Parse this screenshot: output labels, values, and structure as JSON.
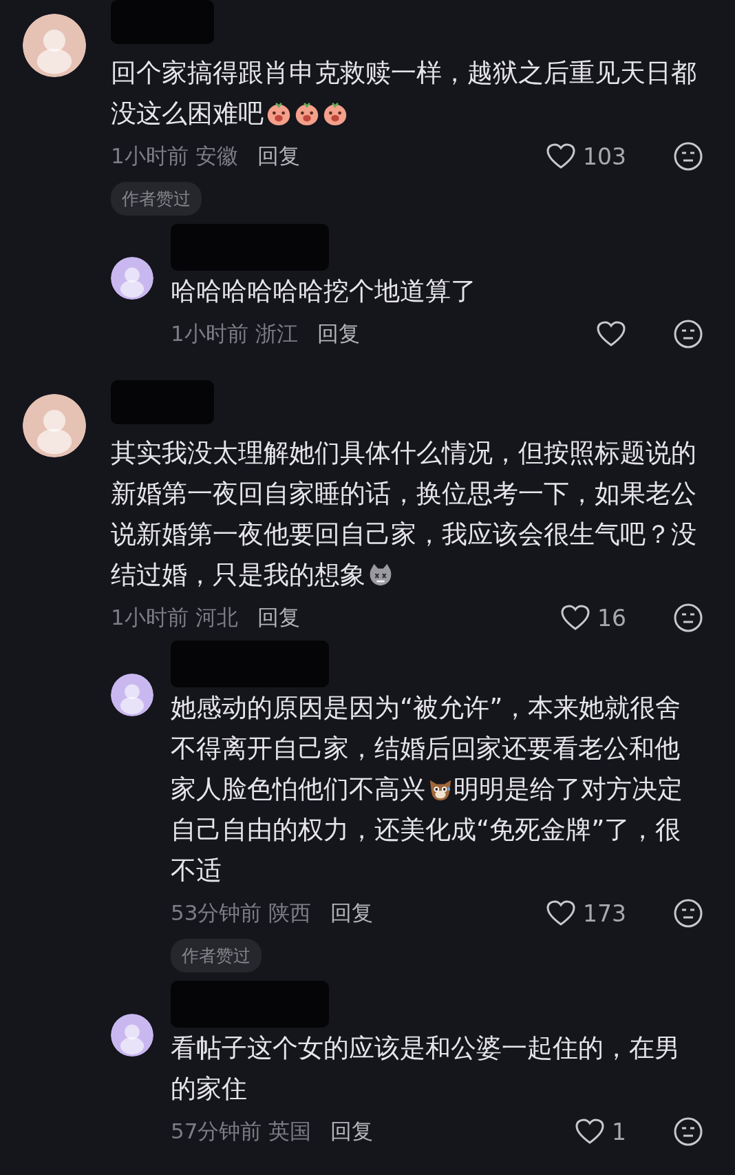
{
  "comments": [
    {
      "lines": [
        [
          {
            "kind": "text",
            "text": "回个家搞得跟肖申克救赎一样，越狱之后重见天日都"
          }
        ],
        [
          {
            "kind": "text",
            "text": "没这么困难吧"
          },
          {
            "kind": "peach-emoji"
          },
          {
            "kind": "peach-emoji"
          },
          {
            "kind": "peach-emoji"
          }
        ]
      ],
      "time": "1小时前",
      "location": "安徽",
      "reply": "回复",
      "likes": "103",
      "badge": "作者赞过",
      "replies": [
        {
          "lines": [
            [
              {
                "kind": "text",
                "text": "哈哈哈哈哈哈挖个地道算了"
              }
            ]
          ],
          "time": "1小时前",
          "location": "浙江",
          "reply": "回复"
        }
      ]
    },
    {
      "lines": [
        [
          {
            "kind": "text",
            "text": "其实我没太理解她们具体什么情况，但按照标题说的"
          }
        ],
        [
          {
            "kind": "text",
            "text": "新婚第一夜回自家睡的话，换位思考一下，如果老公"
          }
        ],
        [
          {
            "kind": "text",
            "text": "说新婚第一夜他要回自己家，我应该会很生气吧？没"
          }
        ],
        [
          {
            "kind": "text",
            "text": "结过婚，只是我的想象"
          },
          {
            "kind": "cat-emoji"
          }
        ]
      ],
      "time": "1小时前",
      "location": "河北",
      "reply": "回复",
      "likes": "16",
      "replies": [
        {
          "lines": [
            [
              {
                "kind": "text",
                "text": "她感动的原因是因为“被允许”，本来她就很舍"
              }
            ],
            [
              {
                "kind": "text",
                "text": "不得离开自己家，结婚后回家还要看老公和他"
              }
            ],
            [
              {
                "kind": "text",
                "text": "家人脸色怕他们不高兴"
              },
              {
                "kind": "fox-emoji"
              },
              {
                "kind": "text",
                "text": "明明是给了对方决定"
              }
            ],
            [
              {
                "kind": "text",
                "text": "自己自由的权力，还美化成“免死金牌”了，很"
              }
            ],
            [
              {
                "kind": "text",
                "text": "不适"
              }
            ]
          ],
          "time": "53分钟前",
          "location": "陕西",
          "reply": "回复",
          "likes": "173",
          "badge": "作者赞过"
        },
        {
          "lines": [
            [
              {
                "kind": "text",
                "text": "看帖子这个女的应该是和公婆一起住的，在男"
              }
            ],
            [
              {
                "kind": "text",
                "text": "的家住"
              }
            ]
          ],
          "time": "57分钟前",
          "location": "英国",
          "reply": "回复",
          "likes": "1"
        }
      ]
    }
  ]
}
